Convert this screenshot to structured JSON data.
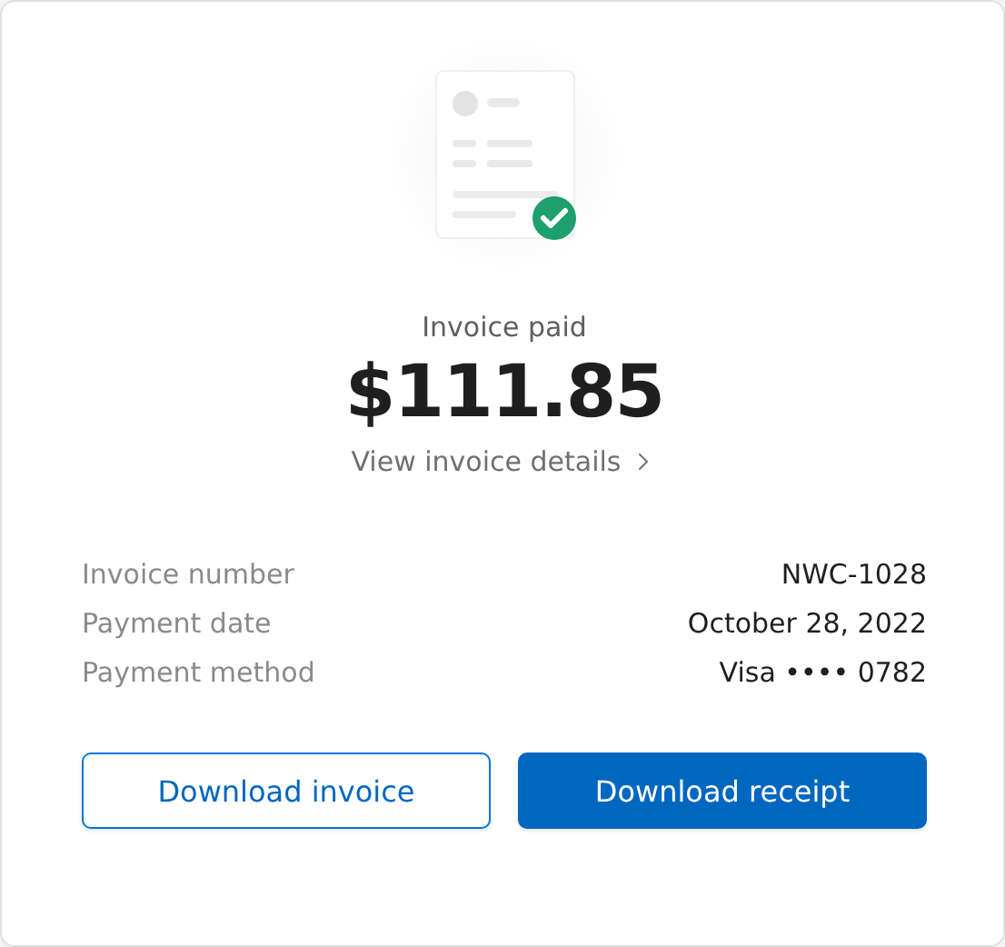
{
  "status": "Invoice paid",
  "amount": "$111.85",
  "details_link": "View invoice details",
  "rows": [
    {
      "label": "Invoice number",
      "value": "NWC-1028"
    },
    {
      "label": "Payment date",
      "value": "October 28, 2022"
    },
    {
      "label": "Payment method",
      "value": "Visa •••• 0782"
    }
  ],
  "buttons": [
    {
      "label": "Download invoice",
      "kind": "secondary"
    },
    {
      "label": "Download receipt",
      "kind": "primary"
    }
  ]
}
